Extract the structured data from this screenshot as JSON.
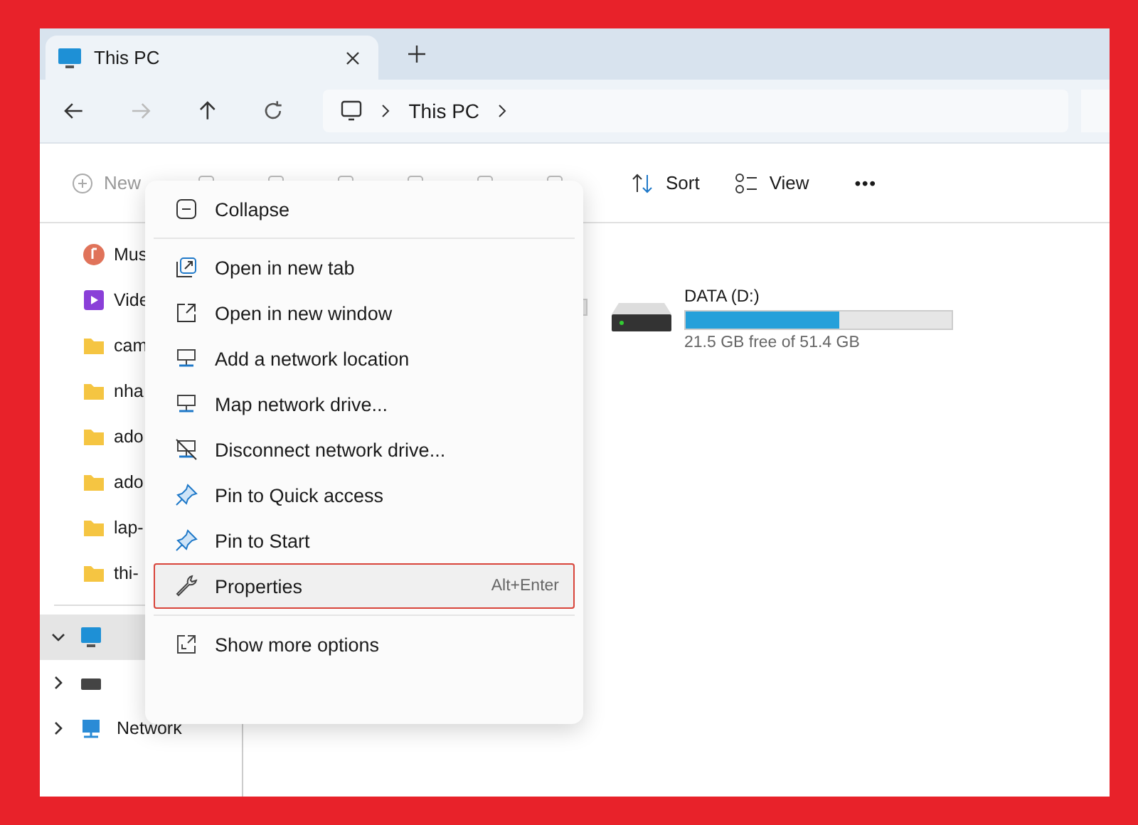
{
  "tabs": [
    {
      "title": "This PC",
      "selected": true
    }
  ],
  "address": {
    "crumb": "This PC"
  },
  "toolbar": {
    "new_label": "New",
    "sort_label": "Sort",
    "view_label": "View",
    "more": "•••"
  },
  "sidebar": {
    "items": [
      {
        "label": "Mus",
        "kind": "music"
      },
      {
        "label": "Vide",
        "kind": "video"
      },
      {
        "label": "cam",
        "kind": "folder"
      },
      {
        "label": "nha",
        "kind": "folder"
      },
      {
        "label": "ado",
        "kind": "folder"
      },
      {
        "label": "ado",
        "kind": "folder"
      },
      {
        "label": "lap-",
        "kind": "folder"
      },
      {
        "label": "thi-",
        "kind": "folder"
      }
    ],
    "tree": [
      {
        "kind": "pc",
        "expanded": true,
        "selected": true
      },
      {
        "kind": "drive",
        "expanded": false,
        "selected": false
      },
      {
        "label": "Network",
        "kind": "network",
        "expanded": false,
        "selected": false
      }
    ]
  },
  "drives": [
    {
      "name": "DATA (D:)",
      "level": 0.58,
      "free": "21.5 GB free of 51.4 GB"
    }
  ],
  "context_menu": {
    "items": [
      {
        "kind": "collapse",
        "label": "Collapse",
        "selected": false
      },
      {
        "kind": "separator"
      },
      {
        "kind": "newtab",
        "label": "Open in new tab",
        "selected": false
      },
      {
        "kind": "newwindow",
        "label": "Open in new window",
        "selected": false
      },
      {
        "kind": "network",
        "label": "Add a network location",
        "selected": false
      },
      {
        "kind": "network",
        "label": "Map network drive...",
        "selected": false
      },
      {
        "kind": "disconnect",
        "label": "Disconnect network drive...",
        "selected": false
      },
      {
        "kind": "pin",
        "label": "Pin to Quick access",
        "selected": false
      },
      {
        "kind": "pin",
        "label": "Pin to Start",
        "selected": false
      },
      {
        "kind": "properties",
        "label": "Properties",
        "shortcut": "Alt+Enter",
        "selected": true
      },
      {
        "kind": "separator"
      },
      {
        "kind": "more",
        "label": "Show more options",
        "selected": false
      }
    ]
  }
}
